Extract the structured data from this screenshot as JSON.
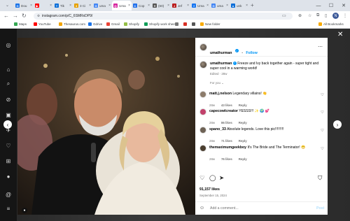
{
  "tabs": [
    {
      "title": "Dou",
      "color": "#1a73e8",
      "glyph": "G"
    },
    {
      "title": "",
      "color": "#ff0000",
      "glyph": "▶"
    },
    {
      "title": "Tik",
      "color": "#0b6ed8",
      "glyph": "T"
    },
    {
      "title": "3 Ci",
      "color": "#e5a000",
      "glyph": "3"
    },
    {
      "title": "uma",
      "color": "#4285f4",
      "glyph": "G"
    },
    {
      "title": "Uma",
      "color": "#d6249f",
      "glyph": "◎"
    },
    {
      "title": "Cop",
      "color": "#1f6feb",
      "glyph": "C"
    },
    {
      "title": "(60)",
      "color": "#555555",
      "glyph": "✕"
    },
    {
      "title": "Jef",
      "color": "#b91c1c",
      "glyph": "J"
    },
    {
      "title": "Uma",
      "color": "#1877f2",
      "glyph": "f"
    },
    {
      "title": "uma",
      "color": "#4285f4",
      "glyph": "G"
    },
    {
      "title": "unk",
      "color": "#0b6ed8",
      "glyph": "u"
    }
  ],
  "window": {
    "minimize": "—",
    "maximize": "☐",
    "close": "✕"
  },
  "address": {
    "url": "instagram.com/p/C_6SMRxDP9/"
  },
  "bookmarks": [
    {
      "label": "Maps",
      "color": "#34a853"
    },
    {
      "label": "YouTube",
      "color": "#ff0000"
    },
    {
      "label": "Thesaurus.com",
      "color": "#f2a400"
    },
    {
      "label": "Gdrive",
      "color": "#1a73e8"
    },
    {
      "label": "Gmail",
      "color": "#ea4335"
    },
    {
      "label": "Shopify",
      "color": "#95bf47"
    },
    {
      "label": "Shopify work sheet",
      "color": "#0f9d58"
    },
    {
      "label": "",
      "color": "#777777"
    },
    {
      "label": "",
      "color": "#d93025"
    },
    {
      "label": "",
      "color": "#555555"
    },
    {
      "label": "New folder",
      "color": "#f9ab00"
    }
  ],
  "all_bookmarks": "All Bookmarks",
  "post": {
    "username": "umathurman",
    "follow_label": "Follow",
    "separator": "•",
    "caption": "Freeze and Ivy back together again - super tight and super cool in a warming world!",
    "caption_meta": "Edited · 28w",
    "for_you": "For you",
    "comments": [
      {
        "user": "matt.j.nelson",
        "text": "Legendary villains! 👏",
        "age": "28w",
        "likes": "43 likes",
        "reply": "Reply"
      },
      {
        "user": "capecowlcreator",
        "text": "YESSS!!! ✨ 🌍 💕",
        "age": "28w",
        "likes": "86 likes",
        "reply": "Reply"
      },
      {
        "user": "spano_33",
        "text": "Absolute legends. Love this pic!!!!!!!!!",
        "age": "28w",
        "likes": "71 likes",
        "reply": "Reply"
      },
      {
        "user": "themaximumgeekboy",
        "text": "It's The Bride and The Terminator! 😁",
        "age": "28w",
        "likes": "76 likes",
        "reply": "Reply"
      }
    ],
    "likes": "91,157 likes",
    "date": "September 15, 2024",
    "add_comment_placeholder": "Add a comment...",
    "post_label": "Post"
  }
}
